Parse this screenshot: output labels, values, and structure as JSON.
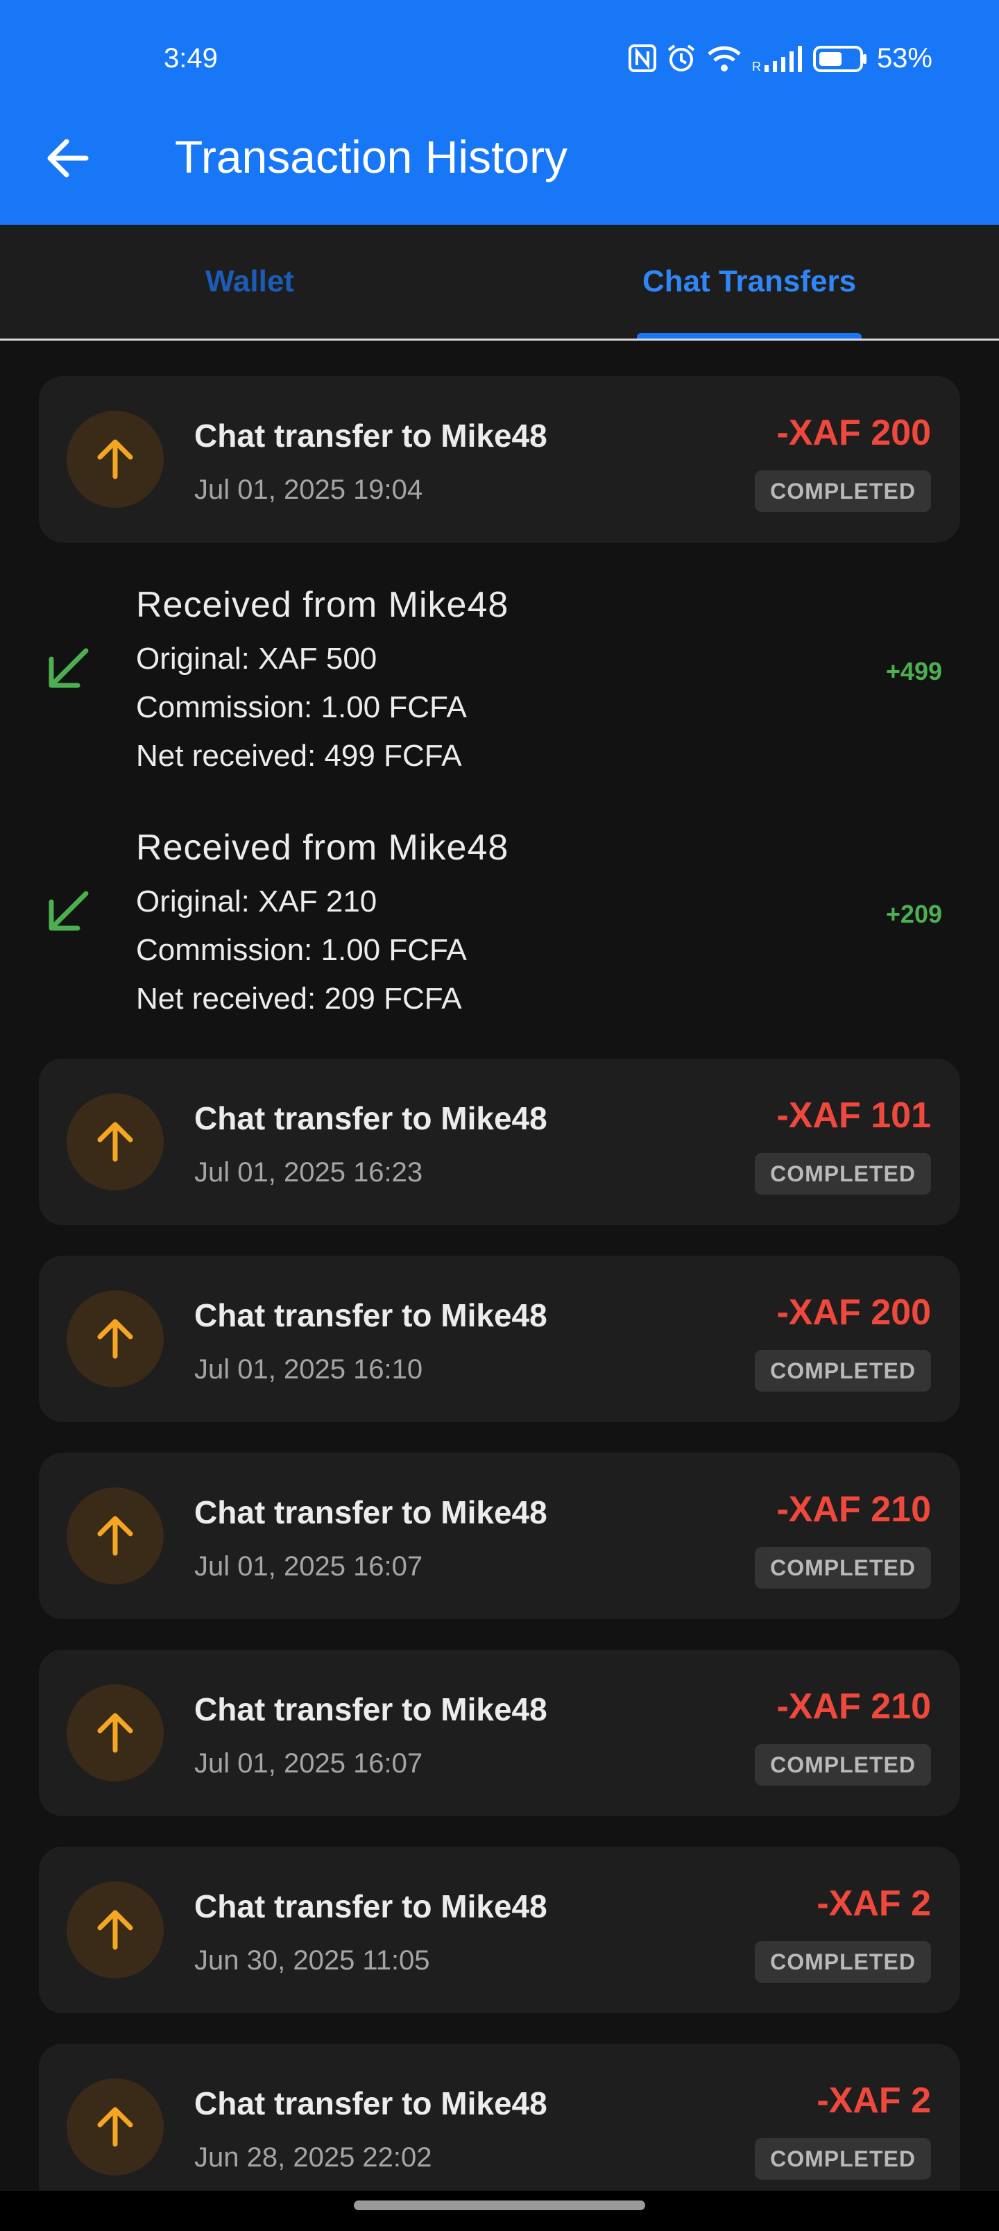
{
  "status_bar": {
    "time": "3:49",
    "battery": "53%"
  },
  "appbar": {
    "title": "Transaction History"
  },
  "tabs": [
    {
      "label": "Wallet",
      "selected": false
    },
    {
      "label": "Chat Transfers",
      "selected": true
    }
  ],
  "colors": {
    "accent": "#1877f7",
    "debit": "#f0483c",
    "credit": "#4caf50",
    "outgoing_icon": "#f5a623"
  },
  "items": [
    {
      "type": "sent",
      "title": "Chat transfer to Mike48",
      "date": "Jul 01, 2025 19:04",
      "amount": "-XAF 200",
      "status": "COMPLETED"
    },
    {
      "type": "received",
      "title": "Received from Mike48",
      "original": "Original: XAF 500",
      "commission": "Commission: 1.00 FCFA",
      "net": "Net received: 499 FCFA",
      "amount": "+499"
    },
    {
      "type": "received",
      "title": "Received from Mike48",
      "original": "Original: XAF 210",
      "commission": "Commission: 1.00 FCFA",
      "net": "Net received: 209 FCFA",
      "amount": "+209"
    },
    {
      "type": "sent",
      "title": "Chat transfer to Mike48",
      "date": "Jul 01, 2025 16:23",
      "amount": "-XAF 101",
      "status": "COMPLETED"
    },
    {
      "type": "sent",
      "title": "Chat transfer to Mike48",
      "date": "Jul 01, 2025 16:10",
      "amount": "-XAF 200",
      "status": "COMPLETED"
    },
    {
      "type": "sent",
      "title": "Chat transfer to Mike48",
      "date": "Jul 01, 2025 16:07",
      "amount": "-XAF 210",
      "status": "COMPLETED"
    },
    {
      "type": "sent",
      "title": "Chat transfer to Mike48",
      "date": "Jul 01, 2025 16:07",
      "amount": "-XAF 210",
      "status": "COMPLETED"
    },
    {
      "type": "sent",
      "title": "Chat transfer to Mike48",
      "date": "Jun 30, 2025 11:05",
      "amount": "-XAF 2",
      "status": "COMPLETED"
    },
    {
      "type": "sent",
      "title": "Chat transfer to Mike48",
      "date": "Jun 28, 2025 22:02",
      "amount": "-XAF 2",
      "status": "COMPLETED"
    }
  ]
}
